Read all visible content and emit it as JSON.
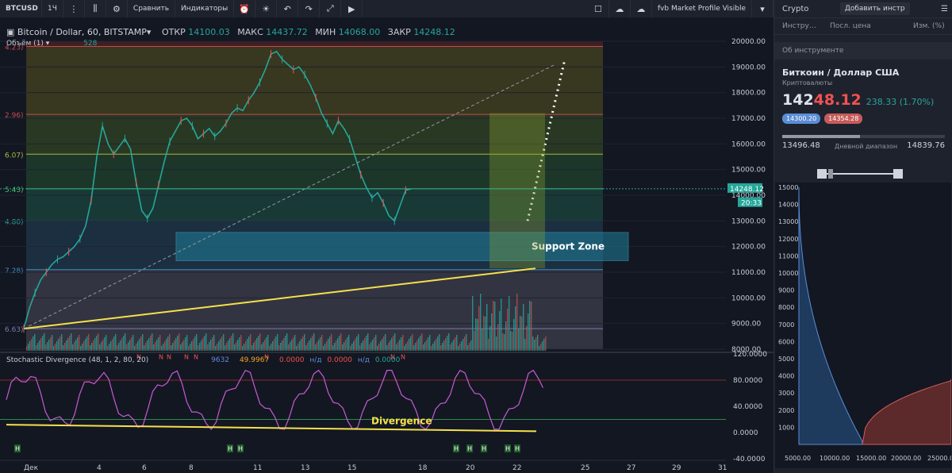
{
  "toolbar": {
    "symbol": "BTCUSD",
    "interval": "1Ч",
    "compare": "Сравнить",
    "indicators": "Индикаторы",
    "study": "fvb Market Profile Visible"
  },
  "legend": {
    "title": "Bitcoin / Dollar, 60, BITSTAMP",
    "o_lbl": "ОТКР",
    "o": "14100.03",
    "h_lbl": "МАКС",
    "h": "14437.72",
    "l_lbl": "МИН",
    "l": "14068.00",
    "c_lbl": "ЗАКР",
    "c": "14248.12",
    "volume": "Объём (1)",
    "volume_val": "528"
  },
  "osc_legend": {
    "title": "Stochastic Divergence (48, 1, 2, 80, 20)",
    "v1": "49.9967",
    "v2": "0.0000",
    "v3": "0.0000",
    "v4": "0.0000",
    "na1": "н/д",
    "na2": "н/д",
    "v1_prefix": "9632"
  },
  "chart_data": [
    {
      "type": "line",
      "title": "Bitcoin / Dollar, 60, BITSTAMP",
      "x_ticks": [
        "Дек",
        "4",
        "6",
        "8",
        "11",
        "13",
        "15",
        "18",
        "20",
        "22",
        "25",
        "27",
        "29",
        "31"
      ],
      "y_ticks": [
        "20000.00",
        "19000.00",
        "18000.00",
        "17000.00",
        "16000.00",
        "15000.00",
        "14000.00",
        "13000.00",
        "12000.00",
        "11000.00",
        "10000.00",
        "9000.00",
        "8000.00"
      ],
      "ylim": [
        8000,
        20000
      ],
      "series": [
        {
          "x_day": [
            0,
            1,
            2,
            3,
            4,
            5,
            6,
            7,
            8,
            9,
            10,
            11,
            12,
            13,
            14,
            15,
            16,
            17,
            18,
            19,
            20,
            21,
            22,
            23,
            24,
            25,
            26,
            27,
            28,
            29,
            30,
            31,
            32,
            33,
            34,
            35,
            36,
            37,
            38,
            39,
            40,
            41,
            42,
            43,
            44,
            45,
            46,
            47,
            48,
            49,
            50,
            51,
            52,
            53,
            54,
            55,
            56,
            57,
            58,
            59,
            60,
            61,
            62,
            63,
            64,
            65,
            66,
            67,
            68,
            69,
            70,
            71,
            72,
            73,
            74,
            75,
            76,
            77,
            78,
            79,
            80,
            81,
            82,
            83,
            84,
            85
          ],
          "values": [
            8800,
            9600,
            10200,
            10700,
            11000,
            11300,
            11500,
            11600,
            11800,
            12000,
            12300,
            12800,
            13800,
            15500,
            16700,
            16000,
            15600,
            15900,
            16200,
            15800,
            14500,
            13400,
            13100,
            13500,
            14400,
            15300,
            16100,
            16500,
            16900,
            17000,
            16700,
            16200,
            16400,
            16600,
            16300,
            16500,
            16800,
            17200,
            17400,
            17300,
            17700,
            18000,
            18400,
            18900,
            19500,
            19600,
            19300,
            19100,
            18900,
            19000,
            18700,
            18300,
            17800,
            17200,
            16800,
            16400,
            16900,
            16600,
            16200,
            15500,
            14800,
            14300,
            13900,
            14100,
            13700,
            13200,
            13000,
            13600,
            14200,
            14248,
            null,
            null,
            null,
            null,
            null,
            null,
            null,
            null,
            null,
            null,
            null,
            null,
            null,
            null,
            null,
            null
          ]
        }
      ],
      "fib_levels": [
        {
          "label": "4.23)",
          "value": 19800
        },
        {
          "label": "2.96)",
          "value": 17150
        },
        {
          "label": "6.07)",
          "value": 15600
        },
        {
          "label": "5.43)",
          "value": 14250
        },
        {
          "label": "4.80)",
          "value": 13000
        },
        {
          "label": "7.28)",
          "value": 11100
        },
        {
          "label": "6.63)",
          "value": 8800
        }
      ],
      "last_price": "14248.12",
      "last_sub": "20:33",
      "price_box2": "14000",
      "support_zone": {
        "label": "Support Zone",
        "from": 11450,
        "to": 12550
      },
      "volume_label": "528"
    },
    {
      "type": "line",
      "title": "Stochastic Divergence (48, 1, 2, 80, 20)",
      "y_ticks": [
        "120.0000",
        "80.0000",
        "40.0000",
        "0.0000",
        "-40.0000"
      ],
      "ylim": [
        -40,
        120
      ],
      "annotation": "Divergence",
      "markers_h": [
        "H",
        "H",
        "H",
        "H",
        "H",
        "H",
        "H",
        "H"
      ],
      "markers_n": [
        "N",
        "N",
        "N",
        "N",
        "N",
        "N",
        "N",
        "N"
      ]
    },
    {
      "type": "area",
      "title": "Depth",
      "y_ticks": [
        "15000",
        "14000",
        "13000",
        "12000",
        "11000",
        "10000",
        "9000",
        "8000",
        "7000",
        "6000",
        "5000",
        "4000",
        "3000",
        "2000",
        "1000"
      ],
      "x_ticks": [
        "5000.00",
        "10000.00",
        "15000.00",
        "20000.00",
        "25000.00"
      ]
    }
  ],
  "panel": {
    "title": "Crypto",
    "add_btn": "Добавить инстр",
    "col1": "Инстру…",
    "col2": "Посл. цена",
    "col3": "Изм. (%)",
    "section": "Об инструменте",
    "name": "Биткоин / Доллар США",
    "sub": "Криптовалюты",
    "price_a": "142",
    "price_b": "48.12",
    "change": "238.33 (1.70%)",
    "bid": "14300.20",
    "ask": "14354.28",
    "range_lo": "13496.48",
    "range_hi": "14839.76",
    "range_lbl": "Дневной диапазон"
  },
  "colors": {
    "bg": "#131722",
    "up": "#26a69a",
    "down": "#ef5350",
    "yellow": "#f5e14b",
    "support": "#1f7f9a",
    "bid": "#5b8dd6",
    "ask": "#d65b5b"
  }
}
